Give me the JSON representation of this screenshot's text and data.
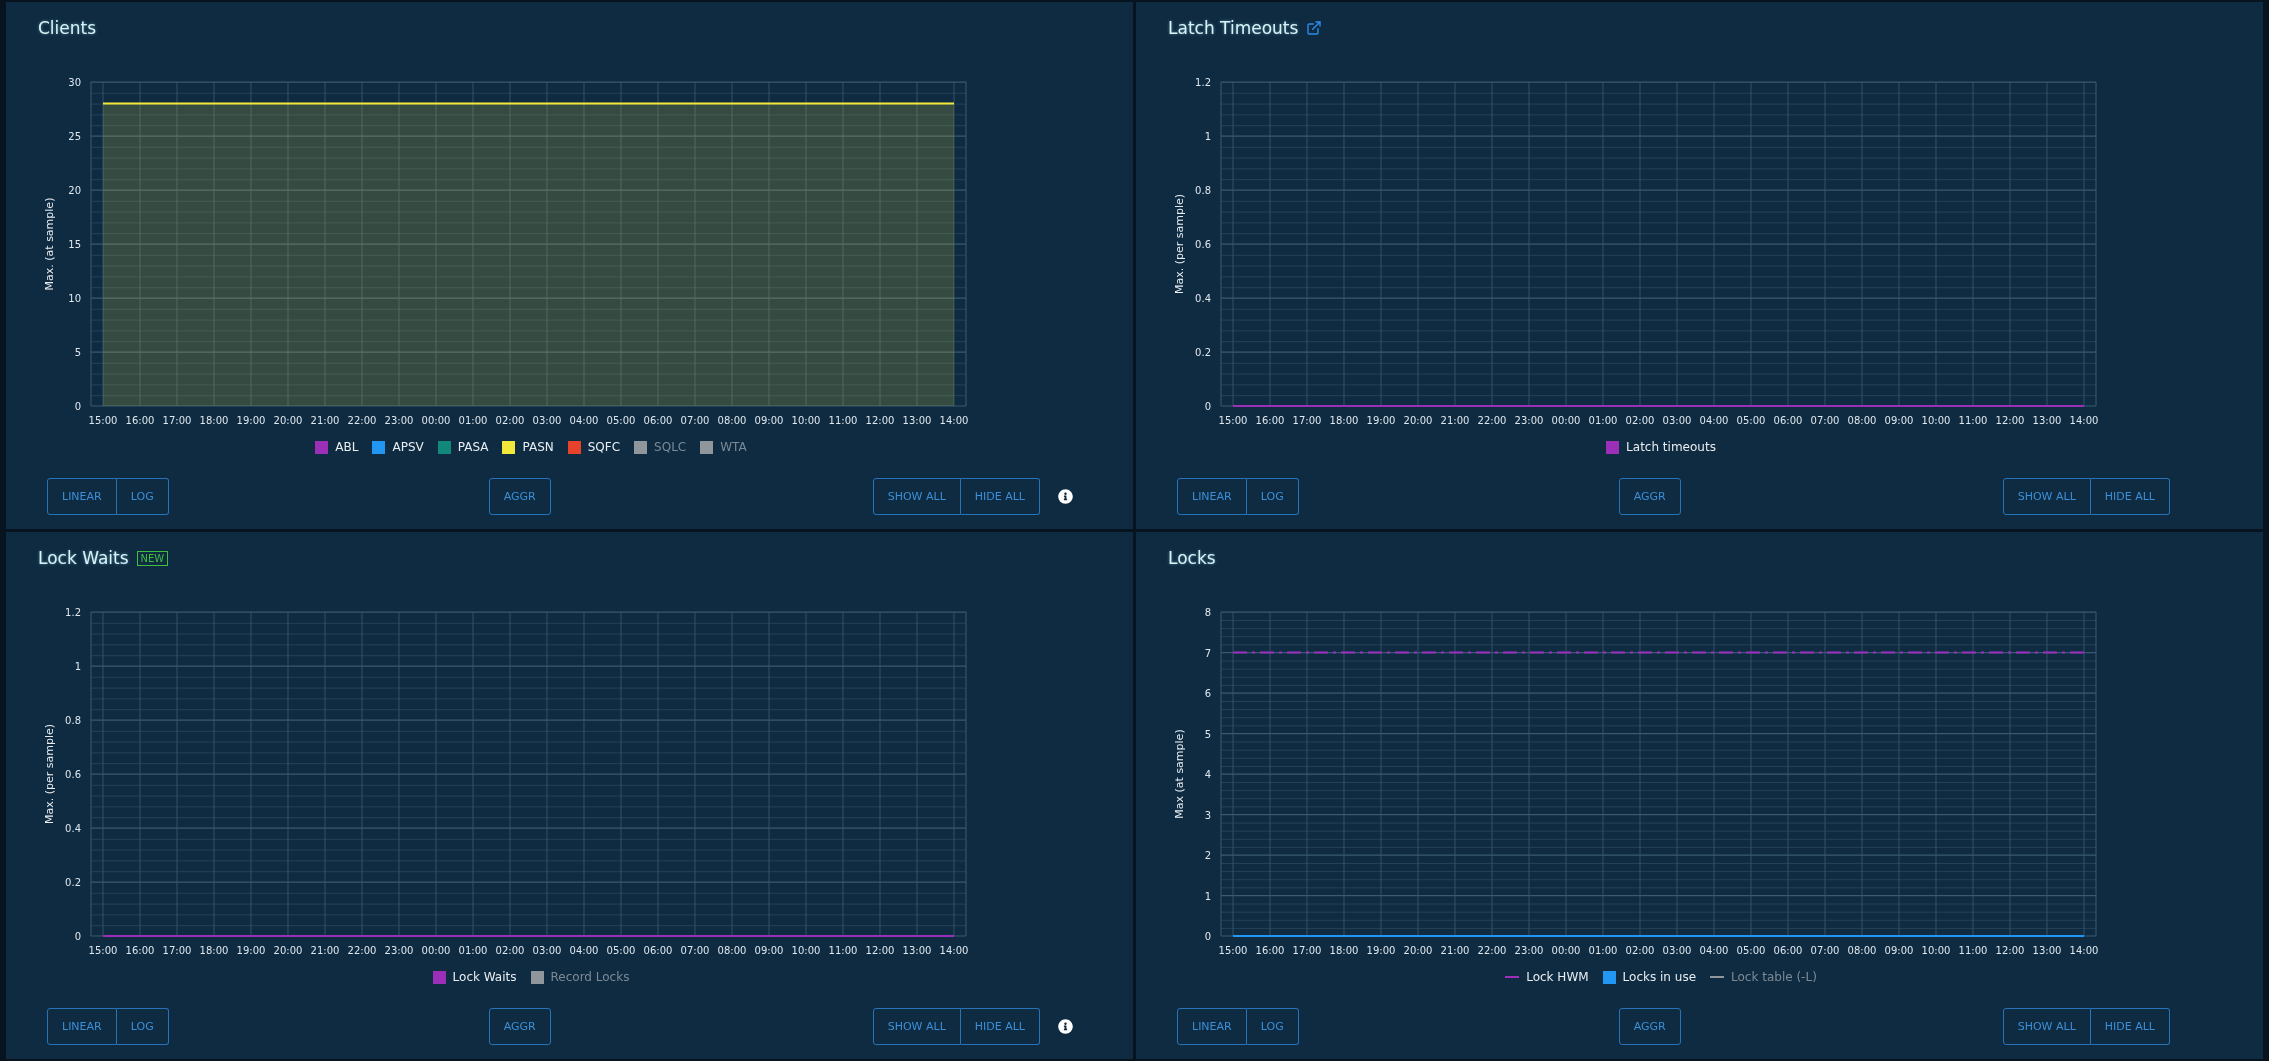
{
  "panels": [
    {
      "title": "Clients",
      "info": true,
      "chart_data": {
        "type": "area",
        "grid": true,
        "ylabel": "Max. (at sample)",
        "x": [
          "15:00",
          "16:00",
          "17:00",
          "18:00",
          "19:00",
          "20:00",
          "21:00",
          "22:00",
          "23:00",
          "00:00",
          "01:00",
          "02:00",
          "03:00",
          "04:00",
          "05:00",
          "06:00",
          "07:00",
          "08:00",
          "09:00",
          "10:00",
          "11:00",
          "12:00",
          "13:00",
          "14:00"
        ],
        "ylim": [
          0,
          30
        ],
        "yticks": [
          0,
          5,
          10,
          15,
          20,
          25,
          30
        ],
        "series": [
          {
            "name": "ABL",
            "color": "#9b2fb8",
            "values": [
              null,
              null,
              null,
              null,
              null,
              null,
              null,
              null,
              null,
              null,
              null,
              null,
              null,
              null,
              null,
              null,
              null,
              null,
              null,
              null,
              null,
              null,
              null,
              null
            ]
          },
          {
            "name": "APSV",
            "color": "#2196f3",
            "values": [
              null,
              null,
              null,
              null,
              null,
              null,
              null,
              null,
              null,
              null,
              null,
              null,
              null,
              null,
              null,
              null,
              null,
              null,
              null,
              null,
              null,
              null,
              null,
              null
            ]
          },
          {
            "name": "PASA",
            "color": "#11887a",
            "values": [
              null,
              null,
              null,
              null,
              null,
              null,
              null,
              null,
              null,
              null,
              null,
              null,
              null,
              null,
              null,
              null,
              null,
              null,
              null,
              null,
              null,
              null,
              null,
              null
            ]
          },
          {
            "name": "PASN",
            "color": "#f2e83a",
            "values": [
              28,
              28,
              28,
              28,
              28,
              28,
              28,
              28,
              28,
              28,
              28,
              28,
              28,
              28,
              28,
              28,
              28,
              28,
              28,
              28,
              28,
              28,
              28,
              28
            ]
          },
          {
            "name": "SQFC",
            "color": "#e8412c",
            "values": [
              null,
              null,
              null,
              null,
              null,
              null,
              null,
              null,
              null,
              null,
              null,
              null,
              null,
              null,
              null,
              null,
              null,
              null,
              null,
              null,
              null,
              null,
              null,
              null
            ]
          },
          {
            "name": "SQLC",
            "color": "#8f969c",
            "values": [
              null,
              null,
              null,
              null,
              null,
              null,
              null,
              null,
              null,
              null,
              null,
              null,
              null,
              null,
              null,
              null,
              null,
              null,
              null,
              null,
              null,
              null,
              null,
              null
            ]
          },
          {
            "name": "WTA",
            "color": "#8f969c",
            "values": [
              null,
              null,
              null,
              null,
              null,
              null,
              null,
              null,
              null,
              null,
              null,
              null,
              null,
              null,
              null,
              null,
              null,
              null,
              null,
              null,
              null,
              null,
              null,
              null
            ]
          }
        ]
      },
      "legend_items": [
        {
          "kind": "square",
          "disabled": false
        },
        {
          "kind": "square",
          "disabled": false
        },
        {
          "kind": "square",
          "disabled": false
        },
        {
          "kind": "square",
          "disabled": false
        },
        {
          "kind": "square",
          "disabled": false
        },
        {
          "kind": "square",
          "disabled": true
        },
        {
          "kind": "square",
          "disabled": true
        }
      ],
      "scale_buttons": [
        "LINEAR",
        "LOG"
      ],
      "aggr_button": "AGGR",
      "visibility_buttons": [
        "SHOW ALL",
        "HIDE ALL"
      ]
    },
    {
      "title": "Latch Timeouts",
      "external_link": true,
      "chart_data": {
        "type": "line",
        "grid": true,
        "ylabel": "Max. (per sample)",
        "x": [
          "15:00",
          "16:00",
          "17:00",
          "18:00",
          "19:00",
          "20:00",
          "21:00",
          "22:00",
          "23:00",
          "00:00",
          "01:00",
          "02:00",
          "03:00",
          "04:00",
          "05:00",
          "06:00",
          "07:00",
          "08:00",
          "09:00",
          "10:00",
          "11:00",
          "12:00",
          "13:00",
          "14:00"
        ],
        "ylim": [
          0,
          1.2
        ],
        "yticks": [
          0,
          0.2,
          0.4,
          0.6,
          0.8,
          1,
          1.2
        ],
        "series": [
          {
            "name": "Latch timeouts",
            "color": "#9b2fb8",
            "values": [
              0,
              0,
              0,
              0,
              0,
              0,
              0,
              0,
              0,
              0,
              0,
              0,
              0,
              0,
              0,
              0,
              0,
              0,
              0,
              0,
              0,
              0,
              0,
              0
            ]
          }
        ]
      },
      "legend_items": [
        {
          "kind": "square",
          "disabled": false
        }
      ],
      "scale_buttons": [
        "LINEAR",
        "LOG"
      ],
      "aggr_button": "AGGR",
      "visibility_buttons": [
        "SHOW ALL",
        "HIDE ALL"
      ]
    },
    {
      "title": "Lock Waits",
      "badge": "NEW",
      "info": true,
      "chart_data": {
        "type": "line",
        "grid": true,
        "ylabel": "Max. (per sample)",
        "x": [
          "15:00",
          "16:00",
          "17:00",
          "18:00",
          "19:00",
          "20:00",
          "21:00",
          "22:00",
          "23:00",
          "00:00",
          "01:00",
          "02:00",
          "03:00",
          "04:00",
          "05:00",
          "06:00",
          "07:00",
          "08:00",
          "09:00",
          "10:00",
          "11:00",
          "12:00",
          "13:00",
          "14:00"
        ],
        "ylim": [
          0,
          1.2
        ],
        "yticks": [
          0,
          0.2,
          0.4,
          0.6,
          0.8,
          1,
          1.2
        ],
        "series": [
          {
            "name": "Lock Waits",
            "color": "#9b2fb8",
            "values": [
              0,
              0,
              0,
              0,
              0,
              0,
              0,
              0,
              0,
              0,
              0,
              0,
              0,
              0,
              0,
              0,
              0,
              0,
              0,
              0,
              0,
              0,
              0,
              0
            ]
          },
          {
            "name": "Record Locks",
            "color": "#8f969c",
            "values": [
              null,
              null,
              null,
              null,
              null,
              null,
              null,
              null,
              null,
              null,
              null,
              null,
              null,
              null,
              null,
              null,
              null,
              null,
              null,
              null,
              null,
              null,
              null,
              null
            ]
          }
        ]
      },
      "legend_items": [
        {
          "kind": "square",
          "disabled": false
        },
        {
          "kind": "square",
          "disabled": true
        }
      ],
      "scale_buttons": [
        "LINEAR",
        "LOG"
      ],
      "aggr_button": "AGGR",
      "visibility_buttons": [
        "SHOW ALL",
        "HIDE ALL"
      ]
    },
    {
      "title": "Locks",
      "chart_data": {
        "type": "line",
        "grid": true,
        "ylabel": "Max (at sample)",
        "x": [
          "15:00",
          "16:00",
          "17:00",
          "18:00",
          "19:00",
          "20:00",
          "21:00",
          "22:00",
          "23:00",
          "00:00",
          "01:00",
          "02:00",
          "03:00",
          "04:00",
          "05:00",
          "06:00",
          "07:00",
          "08:00",
          "09:00",
          "10:00",
          "11:00",
          "12:00",
          "13:00",
          "14:00"
        ],
        "ylim": [
          0,
          8
        ],
        "yticks": [
          0,
          1,
          2,
          3,
          4,
          5,
          6,
          7,
          8
        ],
        "series": [
          {
            "name": "Lock HWM",
            "color": "#a02fc0",
            "line_style": "dashdot",
            "values": [
              7,
              7,
              7,
              7,
              7,
              7,
              7,
              7,
              7,
              7,
              7,
              7,
              7,
              7,
              7,
              7,
              7,
              7,
              7,
              7,
              7,
              7,
              7,
              7
            ]
          },
          {
            "name": "Locks in use",
            "color": "#2196f3",
            "values": [
              0,
              0,
              0,
              0,
              0,
              0,
              0,
              0,
              0,
              0,
              0,
              0,
              0,
              0,
              0,
              0,
              0,
              0,
              0,
              0,
              0,
              0,
              0,
              0
            ]
          },
          {
            "name": "Lock table (-L)",
            "color": "#8f969c",
            "values": [
              null,
              null,
              null,
              null,
              null,
              null,
              null,
              null,
              null,
              null,
              null,
              null,
              null,
              null,
              null,
              null,
              null,
              null,
              null,
              null,
              null,
              null,
              null,
              null
            ]
          }
        ]
      },
      "legend_items": [
        {
          "kind": "line",
          "disabled": false
        },
        {
          "kind": "square",
          "disabled": false
        },
        {
          "kind": "line",
          "disabled": true
        }
      ],
      "scale_buttons": [
        "LINEAR",
        "LOG"
      ],
      "aggr_button": "AGGR",
      "visibility_buttons": [
        "SHOW ALL",
        "HIDE ALL"
      ]
    }
  ]
}
